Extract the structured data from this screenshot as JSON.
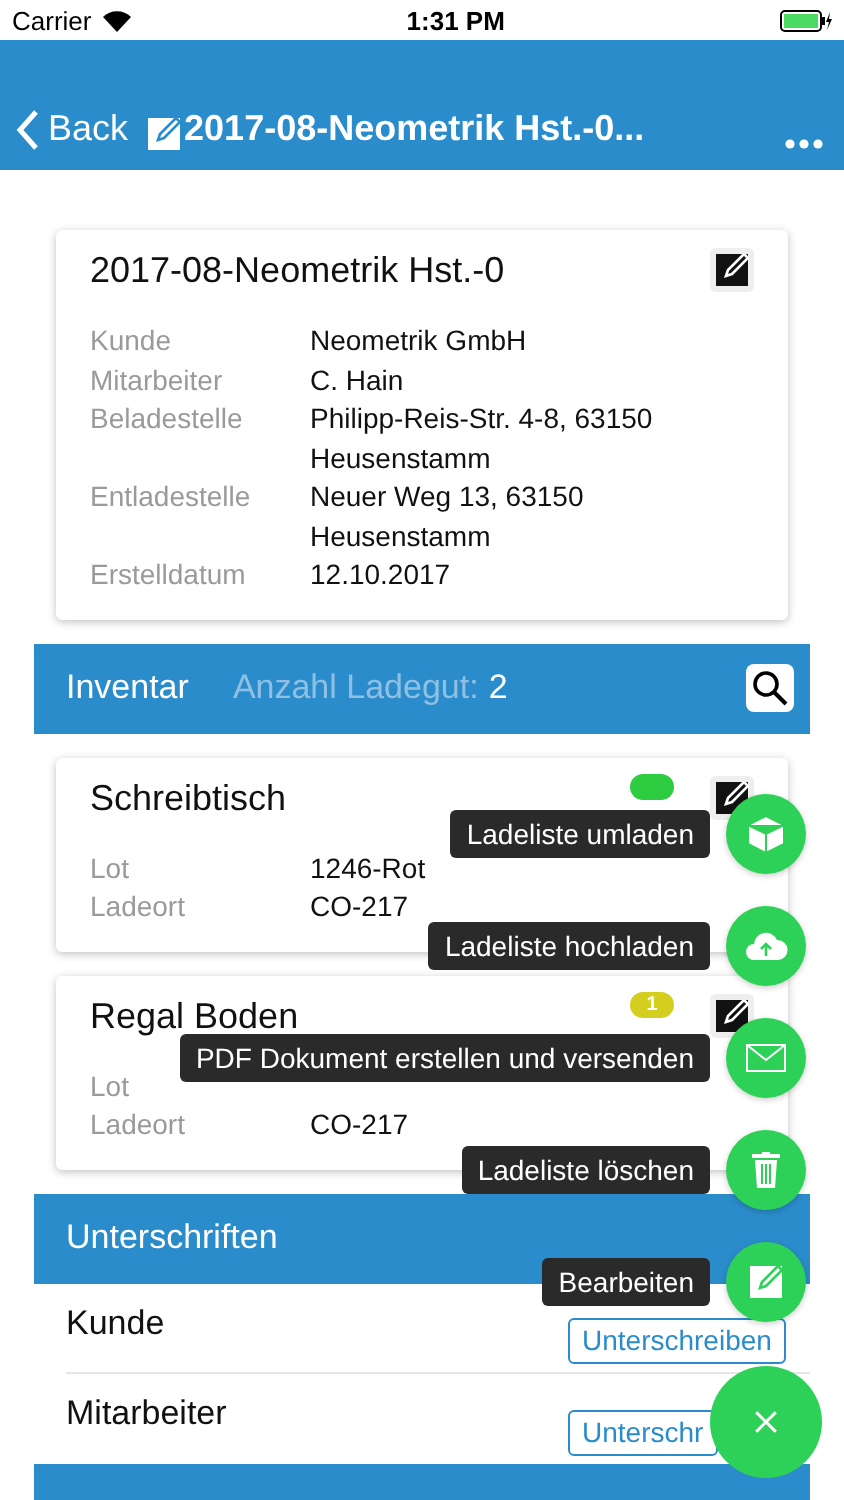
{
  "status_bar": {
    "carrier": "Carrier",
    "time": "1:31 PM"
  },
  "nav": {
    "back": "Back",
    "title": "2017-08-Neometrik Hst.-0..."
  },
  "order": {
    "title": "2017-08-Neometrik Hst.-0",
    "fields": [
      {
        "label": "Kunde",
        "value": "Neometrik GmbH"
      },
      {
        "label": "Mitarbeiter",
        "value": "C. Hain"
      },
      {
        "label": "Beladestelle",
        "value": "Philipp-Reis-Str. 4-8, 63150 Heusenstamm"
      },
      {
        "label": "Entladestelle",
        "value": "Neuer Weg 13, 63150 Heusenstamm"
      },
      {
        "label": "Erstelldatum",
        "value": "12.10.2017"
      }
    ]
  },
  "inventory": {
    "title": "Inventar",
    "count_label": "Anzahl Ladegut:",
    "count": "2",
    "items": [
      {
        "name": "Schreibtisch",
        "badge": {
          "color": "#2ecc40"
        },
        "fields": [
          {
            "label": "Lot",
            "value": "1246-Rot"
          },
          {
            "label": "Ladeort",
            "value": "CO-217"
          }
        ]
      },
      {
        "name": "Regal Boden",
        "badge": {
          "text": "1",
          "color": "#d4cf1e"
        },
        "fields": [
          {
            "label": "Lot"
          },
          {
            "label": "Ladeort",
            "value": "CO-217"
          }
        ]
      }
    ]
  },
  "signatures": {
    "title": "Unterschriften",
    "rows": [
      {
        "label": "Kunde",
        "button": "Unterschreiben"
      },
      {
        "label": "Mitarbeiter",
        "button": "Unterschr"
      }
    ]
  },
  "fab_menu": {
    "open": true,
    "actions": [
      {
        "kind": "cube",
        "label": "Ladeliste umladen"
      },
      {
        "kind": "upload",
        "label": "Ladeliste hochladen"
      },
      {
        "kind": "mail",
        "label": "PDF Dokument erstellen und versenden"
      },
      {
        "kind": "trash",
        "label": "Ladeliste löschen"
      },
      {
        "kind": "edit",
        "label": "Bearbeiten"
      }
    ]
  }
}
